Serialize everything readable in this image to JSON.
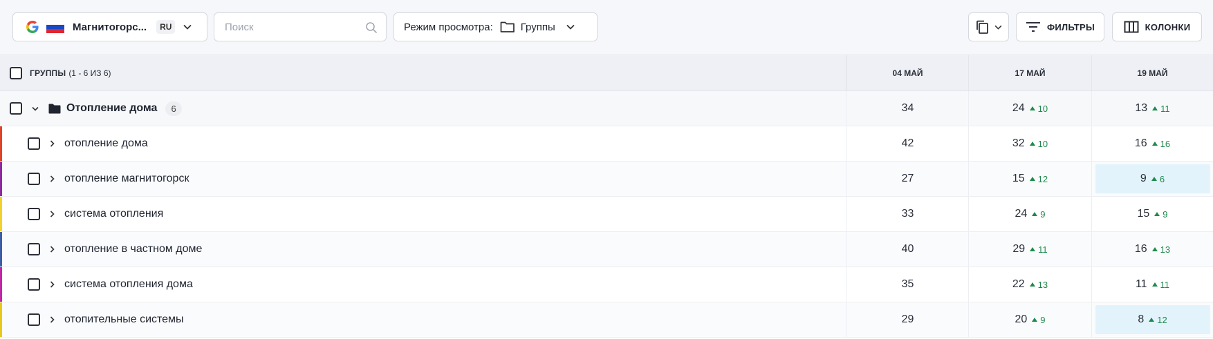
{
  "toolbar": {
    "project": {
      "name": "Магнитогорс...",
      "lang": "RU"
    },
    "search": {
      "placeholder": "Поиск",
      "value": ""
    },
    "view_mode": {
      "label": "Режим просмотра:",
      "value": "Группы"
    },
    "filters_label": "ФИЛЬТРЫ",
    "columns_label": "КОЛОНКИ"
  },
  "table": {
    "groups_header": "ГРУППЫ",
    "groups_range": "(1 - 6 ИЗ 6)",
    "dates": [
      "04 МАЙ",
      "17 МАЙ",
      "19 МАЙ"
    ],
    "group": {
      "name": "Отопление дома",
      "count": "6",
      "values": [
        {
          "v": "34",
          "d": ""
        },
        {
          "v": "24",
          "d": "10"
        },
        {
          "v": "13",
          "d": "11"
        }
      ]
    },
    "rows": [
      {
        "name": "отопление дома",
        "color": "#e0452b",
        "values": [
          {
            "v": "42",
            "d": ""
          },
          {
            "v": "32",
            "d": "10"
          },
          {
            "v": "16",
            "d": "16"
          }
        ]
      },
      {
        "name": "отопление магнитогорск",
        "color": "#8e2aa0",
        "values": [
          {
            "v": "27",
            "d": ""
          },
          {
            "v": "15",
            "d": "12"
          },
          {
            "v": "9",
            "d": "6",
            "hl": true
          }
        ]
      },
      {
        "name": "система отопления",
        "color": "#f2d22e",
        "values": [
          {
            "v": "33",
            "d": ""
          },
          {
            "v": "24",
            "d": "9"
          },
          {
            "v": "15",
            "d": "9"
          }
        ]
      },
      {
        "name": "отопление в частном доме",
        "color": "#3d5fa8",
        "values": [
          {
            "v": "40",
            "d": ""
          },
          {
            "v": "29",
            "d": "11"
          },
          {
            "v": "16",
            "d": "13"
          }
        ]
      },
      {
        "name": "система отопления дома",
        "color": "#c227a8",
        "values": [
          {
            "v": "35",
            "d": ""
          },
          {
            "v": "22",
            "d": "13"
          },
          {
            "v": "11",
            "d": "11"
          }
        ]
      },
      {
        "name": "отопительные системы",
        "color": "#e8c81c",
        "values": [
          {
            "v": "29",
            "d": ""
          },
          {
            "v": "20",
            "d": "9"
          },
          {
            "v": "8",
            "d": "12",
            "hl": true
          }
        ]
      }
    ]
  }
}
